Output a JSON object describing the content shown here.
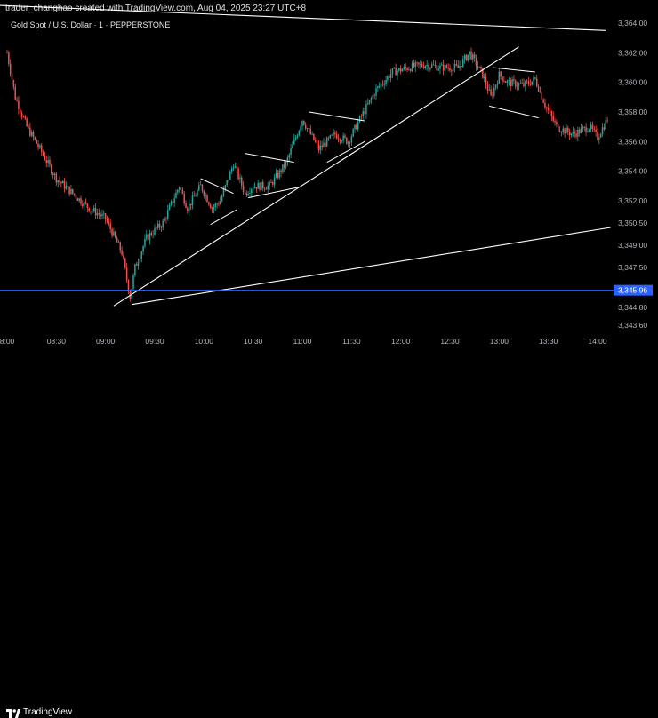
{
  "header": {
    "credit": "trader_changhao created with TradingView.com, Aug 04, 2025 23:27 UTC+8",
    "symbol_legend": "Gold Spot / U.S. Dollar · 1 · PEPPERSTONE"
  },
  "footer": {
    "brand": "TradingView"
  },
  "colors": {
    "background": "#000000",
    "up": "#26a69a",
    "down": "#ef5350",
    "price_line": "#2962ff",
    "drawings": "#ffffff"
  },
  "chart_data": {
    "type": "candlestick",
    "title": "Gold Spot / U.S. Dollar · 1 · PEPPERSTONE",
    "interval": "1 minute",
    "x_tick_labels": [
      "8:00",
      "08:30",
      "09:00",
      "09:30",
      "10:00",
      "10:30",
      "11:00",
      "11:30",
      "12:00",
      "12:30",
      "13:00",
      "13:30",
      "14:00"
    ],
    "y_tick_labels": [
      "3,364.00",
      "3,362.00",
      "3,360.00",
      "3,358.00",
      "3,356.00",
      "3,354.00",
      "3,352.00",
      "3,350.50",
      "3,349.00",
      "3,347.50",
      "3,345.96",
      "3,344.80",
      "3,343.60"
    ],
    "ylim": [
      3343.0,
      3364.6
    ],
    "current_price": 3345.96,
    "current_price_label": "3,345.96",
    "price_path": [
      {
        "t": "08:00",
        "price": 3362.0
      },
      {
        "t": "08:05",
        "price": 3359.0
      },
      {
        "t": "08:12",
        "price": 3357.0
      },
      {
        "t": "08:20",
        "price": 3355.5
      },
      {
        "t": "08:30",
        "price": 3353.5
      },
      {
        "t": "08:40",
        "price": 3352.5
      },
      {
        "t": "08:50",
        "price": 3351.5
      },
      {
        "t": "09:00",
        "price": 3350.8
      },
      {
        "t": "09:10",
        "price": 3348.5
      },
      {
        "t": "09:15",
        "price": 3345.5
      },
      {
        "t": "09:18",
        "price": 3347.5
      },
      {
        "t": "09:25",
        "price": 3349.5
      },
      {
        "t": "09:35",
        "price": 3350.5
      },
      {
        "t": "09:45",
        "price": 3353.0
      },
      {
        "t": "09:50",
        "price": 3351.5
      },
      {
        "t": "09:58",
        "price": 3353.0
      },
      {
        "t": "10:05",
        "price": 3351.5
      },
      {
        "t": "10:10",
        "price": 3352.0
      },
      {
        "t": "10:18",
        "price": 3354.5
      },
      {
        "t": "10:25",
        "price": 3352.5
      },
      {
        "t": "10:30",
        "price": 3353.0
      },
      {
        "t": "10:40",
        "price": 3353.0
      },
      {
        "t": "10:50",
        "price": 3354.5
      },
      {
        "t": "11:00",
        "price": 3357.5
      },
      {
        "t": "11:10",
        "price": 3355.5
      },
      {
        "t": "11:20",
        "price": 3356.5
      },
      {
        "t": "11:28",
        "price": 3356.0
      },
      {
        "t": "11:35",
        "price": 3357.5
      },
      {
        "t": "11:45",
        "price": 3359.5
      },
      {
        "t": "11:55",
        "price": 3360.7
      },
      {
        "t": "12:05",
        "price": 3361.0
      },
      {
        "t": "12:15",
        "price": 3361.2
      },
      {
        "t": "12:25",
        "price": 3361.0
      },
      {
        "t": "12:35",
        "price": 3361.0
      },
      {
        "t": "12:42",
        "price": 3362.0
      },
      {
        "t": "12:50",
        "price": 3360.5
      },
      {
        "t": "12:55",
        "price": 3359.0
      },
      {
        "t": "13:00",
        "price": 3360.5
      },
      {
        "t": "13:05",
        "price": 3360.0
      },
      {
        "t": "13:15",
        "price": 3359.8
      },
      {
        "t": "13:22",
        "price": 3360.2
      },
      {
        "t": "13:28",
        "price": 3358.5
      },
      {
        "t": "13:35",
        "price": 3357.0
      },
      {
        "t": "13:45",
        "price": 3356.5
      },
      {
        "t": "13:55",
        "price": 3357.0
      },
      {
        "t": "14:00",
        "price": 3356.3
      },
      {
        "t": "14:06",
        "price": 3357.5
      }
    ],
    "drawings": [
      {
        "kind": "trendline",
        "from": {
          "t": "06:50",
          "price": 3365.5
        },
        "to": {
          "t": "14:05",
          "price": 3363.5
        }
      },
      {
        "kind": "trendline",
        "from": {
          "t": "09:05",
          "price": 3344.9
        },
        "to": {
          "t": "13:12",
          "price": 3362.4
        }
      },
      {
        "kind": "trendline",
        "from": {
          "t": "09:16",
          "price": 3345.0
        },
        "to": {
          "t": "14:08",
          "price": 3350.2
        }
      },
      {
        "kind": "pattern",
        "from": {
          "t": "09:58",
          "price": 3353.5
        },
        "to": {
          "t": "10:18",
          "price": 3352.5
        }
      },
      {
        "kind": "pattern",
        "from": {
          "t": "10:04",
          "price": 3350.4
        },
        "to": {
          "t": "10:20",
          "price": 3351.4
        }
      },
      {
        "kind": "pattern",
        "from": {
          "t": "10:25",
          "price": 3355.2
        },
        "to": {
          "t": "10:55",
          "price": 3354.6
        }
      },
      {
        "kind": "pattern",
        "from": {
          "t": "10:27",
          "price": 3352.2
        },
        "to": {
          "t": "10:57",
          "price": 3352.9
        }
      },
      {
        "kind": "pattern",
        "from": {
          "t": "11:04",
          "price": 3358.0
        },
        "to": {
          "t": "11:38",
          "price": 3357.4
        }
      },
      {
        "kind": "pattern",
        "from": {
          "t": "11:15",
          "price": 3354.6
        },
        "to": {
          "t": "11:38",
          "price": 3356.0
        }
      },
      {
        "kind": "pattern",
        "from": {
          "t": "12:56",
          "price": 3361.0
        },
        "to": {
          "t": "13:22",
          "price": 3360.7
        }
      },
      {
        "kind": "pattern",
        "from": {
          "t": "12:54",
          "price": 3358.4
        },
        "to": {
          "t": "13:24",
          "price": 3357.6
        }
      }
    ]
  }
}
